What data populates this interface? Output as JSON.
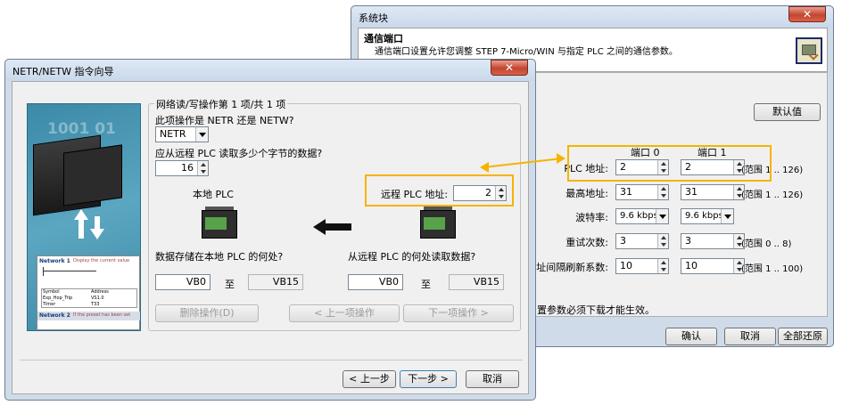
{
  "sysblock": {
    "title": "系统块",
    "close": "✕",
    "header_title": "通信端口",
    "header_desc": "通信端口设置允许您调整 STEP 7-Micro/WIN 与指定 PLC 之间的通信参数。",
    "bg_text": "系统块",
    "default_btn": "默认值",
    "port0": "端口 0",
    "port1": "端口 1",
    "rows": [
      {
        "label": "PLC 地址:",
        "p0": "2",
        "p1": "2",
        "range": "(范围 1 .. 126)"
      },
      {
        "label": "最高地址:",
        "p0": "31",
        "p1": "31",
        "range": "(范围 1 .. 126)"
      },
      {
        "label": "波特率:",
        "p0": "9.6 kbps",
        "p1": "9.6 kbps",
        "range": ""
      },
      {
        "label": "重试次数:",
        "p0": "3",
        "p1": "3",
        "range": "(范围 0 .. 8)"
      },
      {
        "label": "地址间隔刷新系数:",
        "p0": "10",
        "p1": "10",
        "range": "(范围 1 .. 100)"
      }
    ],
    "note": "置参数必须下载才能生效。",
    "ok": "确认",
    "cancel": "取消",
    "restore": "全部还原"
  },
  "wizard": {
    "title": "NETR/NETW 指令向导",
    "close": "✕",
    "group_title": "网络读/写操作第 1 项/共 1 项",
    "q_operation": "此项操作是 NETR 还是 NETW?",
    "operation_value": "NETR",
    "q_bytes": "应从远程 PLC 读取多少个字节的数据?",
    "bytes_value": "16",
    "remote_addr_label": "远程 PLC 地址:",
    "remote_addr_value": "2",
    "local_plc": "本地 PLC",
    "q_store": "数据存储在本地 PLC 的何处?",
    "q_read": "从远程 PLC 的何处读取数据?",
    "local_from": "VB0",
    "local_to": "VB15",
    "remote_from": "VB0",
    "remote_to": "VB15",
    "to_word": "至",
    "delete_btn": "删除操作(D)",
    "prev_op_btn": "< 上一项操作",
    "next_op_btn": "下一项操作 >",
    "back_btn": "< 上一步",
    "next_btn": "下一步 >",
    "cancel_btn": "取消",
    "side_digits": "1001 01",
    "side_net1": "Network 1",
    "side_net1_sub": "Display the current value",
    "side_net2": "Network 2",
    "side_net2_sub": "If the preset has been set",
    "side_tbl": [
      "Symbol",
      "Address",
      "Exp_Hop_Trip",
      "VS1.0",
      "Timer",
      "T33"
    ]
  },
  "colors": {
    "highlight": "#f5b400",
    "title_grad_top": "#dbe6f3",
    "title_grad_bot": "#c6d5e8",
    "sidebar": "#4a92b0"
  }
}
